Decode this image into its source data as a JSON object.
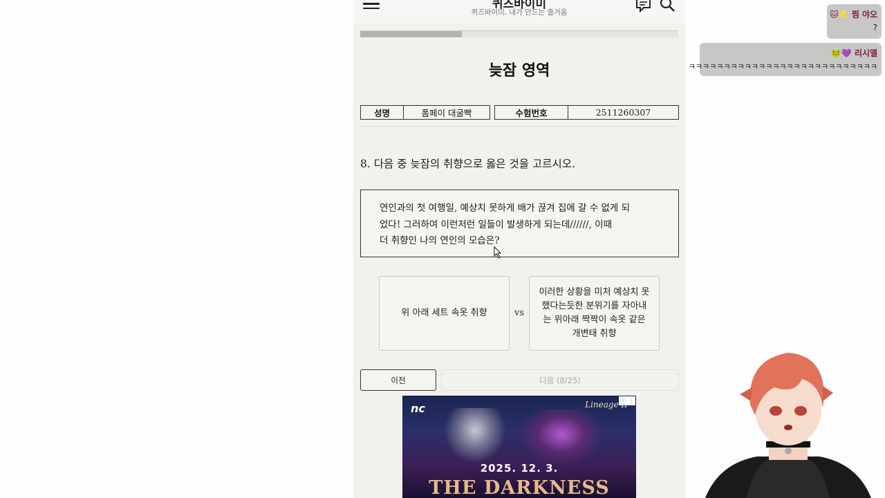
{
  "header": {
    "site_title": "퀴즈바이미",
    "site_subtitle": "퀴즈바이미, 내가 만드는 즐거움",
    "menu_icon": "hamburger-menu-icon",
    "chat_icon": "chat-icon",
    "search_icon": "search-icon"
  },
  "quiz": {
    "progress_fraction": 0.32,
    "section_title": "늦잠 영역",
    "info": {
      "name_label": "성명",
      "name_value": "폼페이 대굴빡",
      "exam_no_label": "수험번호",
      "exam_no_value": "2511260307"
    },
    "question": "8.  다음 중 늦잠의 취향으로 옳은 것을 고르시오.",
    "passage_lines": [
      "연인과의 첫 여행일, 예상치 못하게 배가 끊겨 집에 갈 수 없게 되",
      "었다! 그러하여 이런저런 일들이 발생하게 되는데//////, 이때",
      "더 취향인 나의 연인의 모습은?"
    ],
    "choice_a": "위 아래 세트 속옷 취향",
    "vs_label": "vs",
    "choice_b": "이러한 상황을 미처 예상치 못했다는듯한 분위기를 자아내는 위아래 짝짝이 속옷 같은 개변태 취향",
    "prev_label": "이전",
    "next_label": "다음 (8/25)"
  },
  "ad": {
    "logo": "nc",
    "brand": "Lineage II",
    "date": "2025. 12. 3.",
    "headline": "THE DARKNESS"
  },
  "chat": [
    {
      "name": "🐱⭐ 찜 야오",
      "message": "?"
    },
    {
      "name": "🐸💜 리시엘",
      "message": "ㅋㅋㅋㅋㅋㅋㅋㅋㅋㅋㅋㅋㅋㅋㅋㅋㅋㅋㅋㅋㅋㅋㅋㅋㅋㅋㅋ"
    }
  ],
  "colors": {
    "page_background": "#f1f1ee",
    "chat_bubble": "#c7c7c5",
    "chat_name": "#7a1b3a",
    "next_disabled_text": "#aaaaaa"
  }
}
